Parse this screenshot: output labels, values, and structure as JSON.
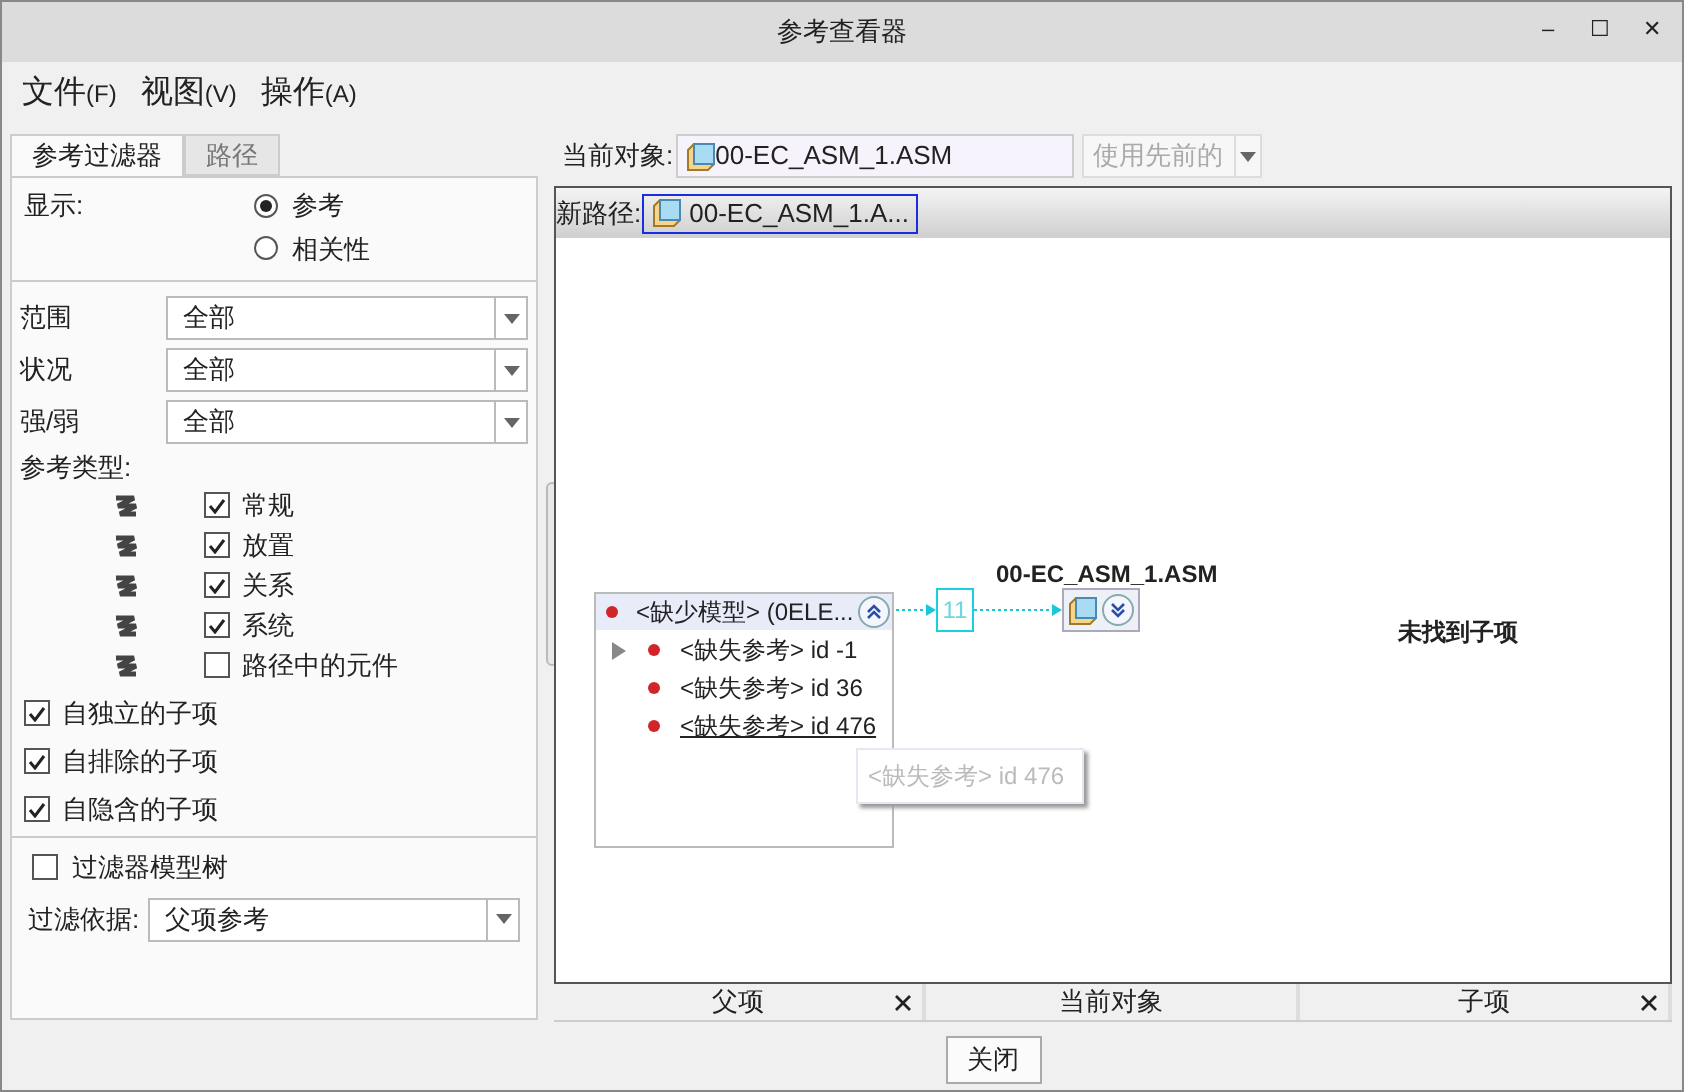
{
  "window": {
    "title": "参考查看器",
    "controls": [
      "–",
      "☐",
      "✕"
    ]
  },
  "menu": [
    {
      "label": "文件",
      "key": "(F)"
    },
    {
      "label": "视图",
      "key": "(V)"
    },
    {
      "label": "操作",
      "key": "(A)"
    }
  ],
  "left_tabs": [
    {
      "label": "参考过滤器",
      "selected": true
    },
    {
      "label": "路径",
      "selected": false
    }
  ],
  "display": {
    "label": "显示:",
    "options": [
      {
        "label": "参考",
        "selected": true
      },
      {
        "label": "相关性",
        "selected": false
      }
    ]
  },
  "filters": [
    {
      "label": "范围",
      "value": "全部"
    },
    {
      "label": "状况",
      "value": "全部"
    },
    {
      "label": "强/弱",
      "value": "全部"
    }
  ],
  "ref_types": {
    "label": "参考类型:",
    "items": [
      {
        "label": "常规",
        "checked": true
      },
      {
        "label": "放置",
        "checked": true
      },
      {
        "label": "关系",
        "checked": true
      },
      {
        "label": "系统",
        "checked": true
      },
      {
        "label": "路径中的元件",
        "checked": false
      }
    ]
  },
  "child_options": [
    {
      "label": "自独立的子项",
      "checked": true
    },
    {
      "label": "自排除的子项",
      "checked": true
    },
    {
      "label": "自隐含的子项",
      "checked": true
    }
  ],
  "model_tree_filter": {
    "label": "过滤器模型树",
    "checked": false
  },
  "filter_by": {
    "label": "过滤依据:",
    "value": "父项参考"
  },
  "current_object": {
    "label": "当前对象:",
    "value": "00-EC_ASM_1.ASM",
    "button": "使用先前的"
  },
  "path_bar": {
    "label": "新路径:",
    "item": "00-EC_ASM_1.A..."
  },
  "canvas": {
    "parent_node": {
      "title": "<缺少模型> (0ELE...",
      "items": [
        {
          "text": "<缺失参考> id -1",
          "expandable": true,
          "underlined": false
        },
        {
          "text": "<缺失参考> id 36",
          "expandable": false,
          "underlined": false
        },
        {
          "text": "<缺失参考> id 476",
          "expandable": false,
          "underlined": true
        }
      ]
    },
    "link_count": "11",
    "current_node": {
      "label": "00-EC_ASM_1.ASM"
    },
    "children_message": "未找到子项",
    "tooltip": "<缺失参考> id 476"
  },
  "bottom_tabs": [
    {
      "label": "父项",
      "closable": true
    },
    {
      "label": "当前对象",
      "closable": false
    },
    {
      "label": "子项",
      "closable": true
    }
  ],
  "close_button": "关闭"
}
